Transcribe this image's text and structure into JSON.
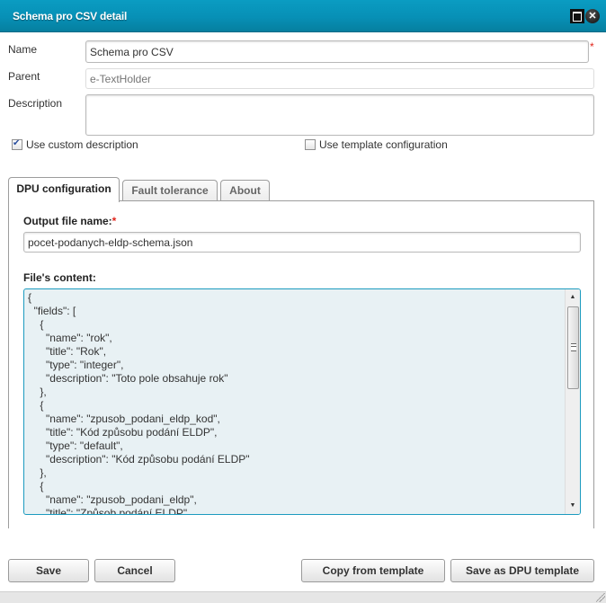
{
  "window": {
    "title": "Schema pro CSV detail",
    "maximize_icon": "maximize-icon",
    "close_icon": "close-icon"
  },
  "form": {
    "name_label": "Name",
    "name_value": "Schema pro CSV",
    "name_required": "*",
    "parent_label": "Parent",
    "parent_placeholder": "e-TextHolder",
    "description_label": "Description",
    "description_value": "",
    "use_custom_description": {
      "label": "Use custom description",
      "checked": true
    },
    "use_template_configuration": {
      "label": "Use template configuration",
      "checked": false
    }
  },
  "tabs": [
    {
      "label": "DPU configuration",
      "active": true
    },
    {
      "label": "Fault tolerance",
      "active": false
    },
    {
      "label": "About",
      "active": false
    }
  ],
  "dpu_config": {
    "output_label": "Output file name:",
    "output_required": "*",
    "output_value": "pocet-podanych-eldp-schema.json",
    "content_label": "File's content:",
    "content_value": "{\n  \"fields\": [\n    {\n      \"name\": \"rok\",\n      \"title\": \"Rok\",\n      \"type\": \"integer\",\n      \"description\": \"Toto pole obsahuje rok\"\n    },\n    {\n      \"name\": \"zpusob_podani_eldp_kod\",\n      \"title\": \"Kód způsobu podání ELDP\",\n      \"type\": \"default\",\n      \"description\": \"Kód způsobu podání ELDP\"\n    },\n    {\n      \"name\": \"zpusob_podani_eldp\",\n      \"title\": \"Způsob podání ELDP\","
  },
  "buttons": {
    "save": "Save",
    "cancel": "Cancel",
    "copy_from_template": "Copy from template",
    "save_as_dpu_template": "Save as DPU template"
  }
}
